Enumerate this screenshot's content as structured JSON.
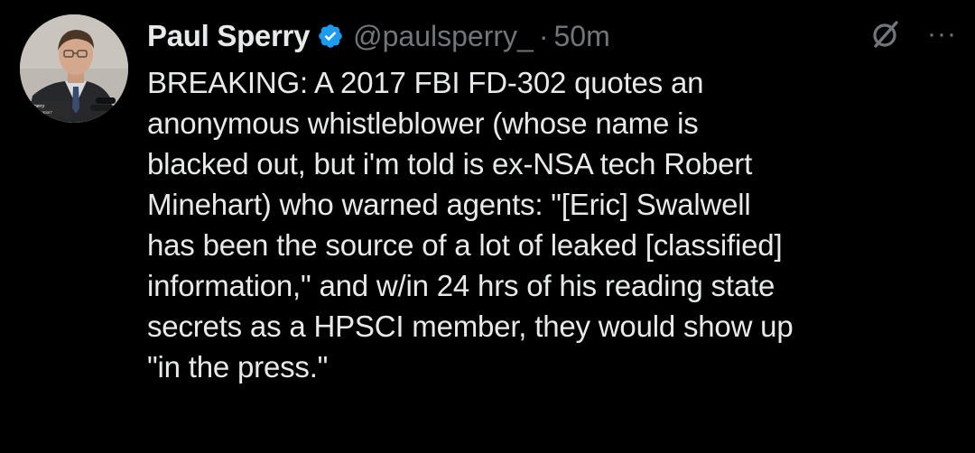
{
  "author": {
    "display_name": "Paul Sperry",
    "handle": "@paulsperry_",
    "separator": "·",
    "time": "50m",
    "verified_icon": "verified-badge-icon",
    "avatar_caption_lines": [
      "l Sperry",
      "ter, \"Infiltration\""
    ]
  },
  "actions": {
    "grok_icon": "grok-icon",
    "more_label": "···"
  },
  "tweet": {
    "lines": [
      "BREAKING: A 2017 FBI FD-302 quotes an",
      "anonymous whistleblower (whose name is",
      "blacked out, but i'm told is ex-NSA tech Robert",
      "Minehart) who warned agents: \"[Eric] Swalwell",
      "has been the source of a lot of leaked [classified]",
      "information,\" and w/in 24 hrs of his reading state",
      "secrets as a HPSCI member, they would show up",
      "\"in the press.\""
    ]
  },
  "colors": {
    "background": "#000000",
    "text": "#e7e9ea",
    "secondary_text": "#71767b",
    "verified_blue": "#1d9bf0"
  }
}
